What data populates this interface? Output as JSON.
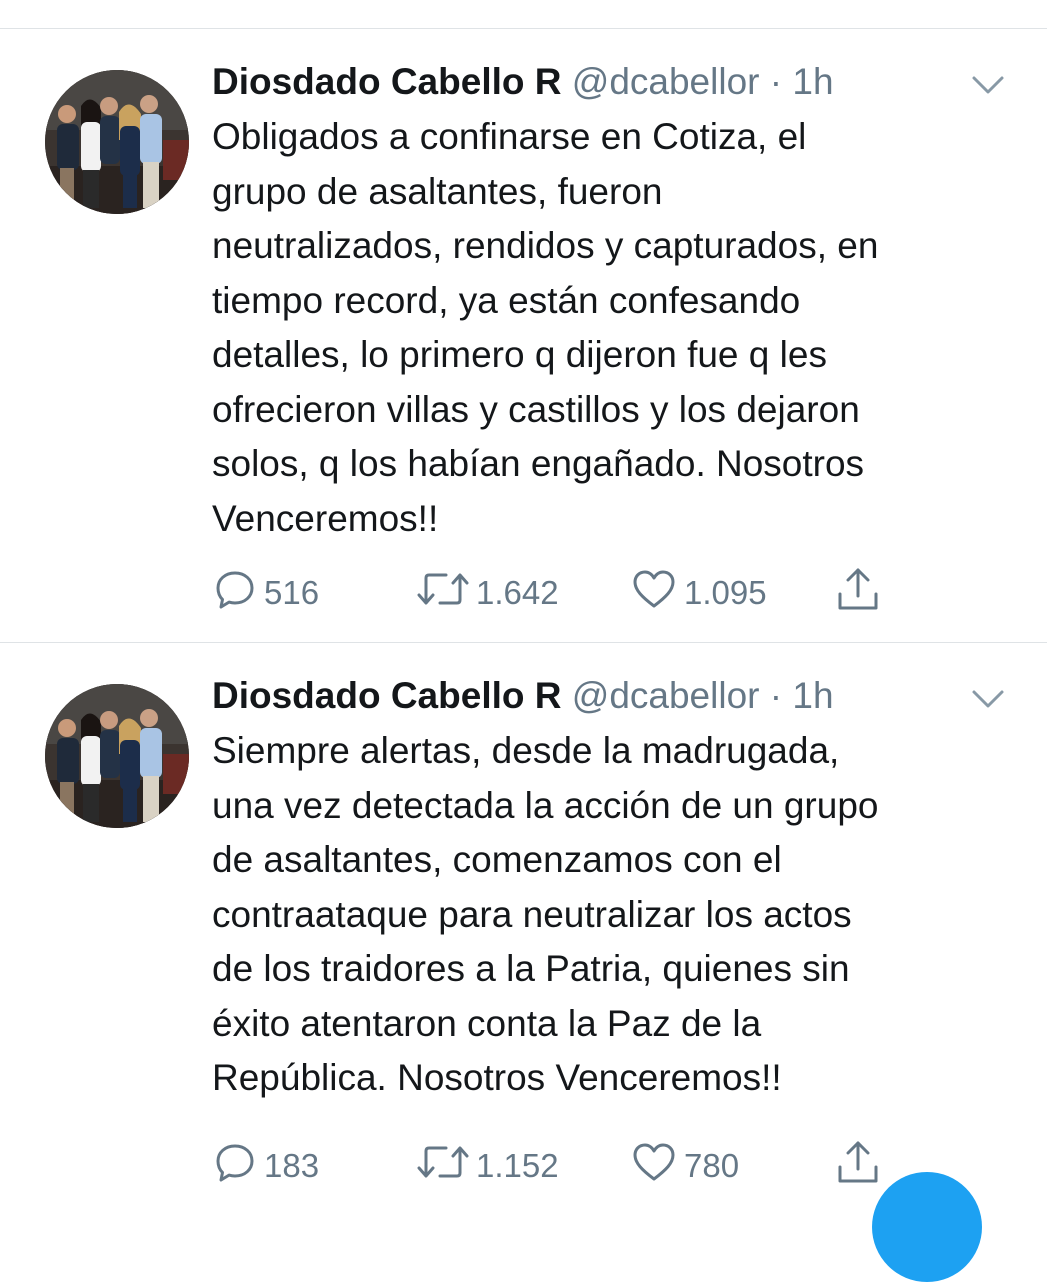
{
  "tweets": [
    {
      "author_name": "Diosdado Cabello R",
      "handle": "@dcabellor",
      "separator": "·",
      "time": "1h",
      "avatar_icon": "profile-photo",
      "menu_icon": "chevron-down-icon",
      "text": "Obligados a confinarse en Cotiza, el\ngrupo de asaltantes, fueron\nneutralizados, rendidos y capturados, en\ntiempo record, ya están confesando\ndetalles, lo primero q dijeron fue q les\nofrecieron villas y castillos y los dejaron\nsolos, q los habían engañado. Nosotros\nVenceremos!!",
      "replies": "516",
      "retweets": "1.642",
      "likes": "1.095"
    },
    {
      "author_name": "Diosdado Cabello R",
      "handle": "@dcabellor",
      "separator": "·",
      "time": "1h",
      "avatar_icon": "profile-photo",
      "menu_icon": "chevron-down-icon",
      "text": "Siempre alertas, desde la madrugada,\nuna vez detectada la acción de un grupo\nde asaltantes, comenzamos con el\ncontraataque para neutralizar los actos\nde los traidores a la Patria, quienes sin\néxito atentaron conta la Paz de la\nRepública. Nosotros Venceremos!!",
      "replies": "183",
      "retweets": "1.152",
      "likes": "780"
    }
  ],
  "icons": {
    "reply": "reply-icon",
    "retweet": "retweet-icon",
    "like": "heart-icon",
    "share": "share-icon"
  },
  "colors": {
    "text": "#14171a",
    "secondary": "#657786",
    "divider": "#dfe3e6",
    "accent": "#1da1f2"
  }
}
